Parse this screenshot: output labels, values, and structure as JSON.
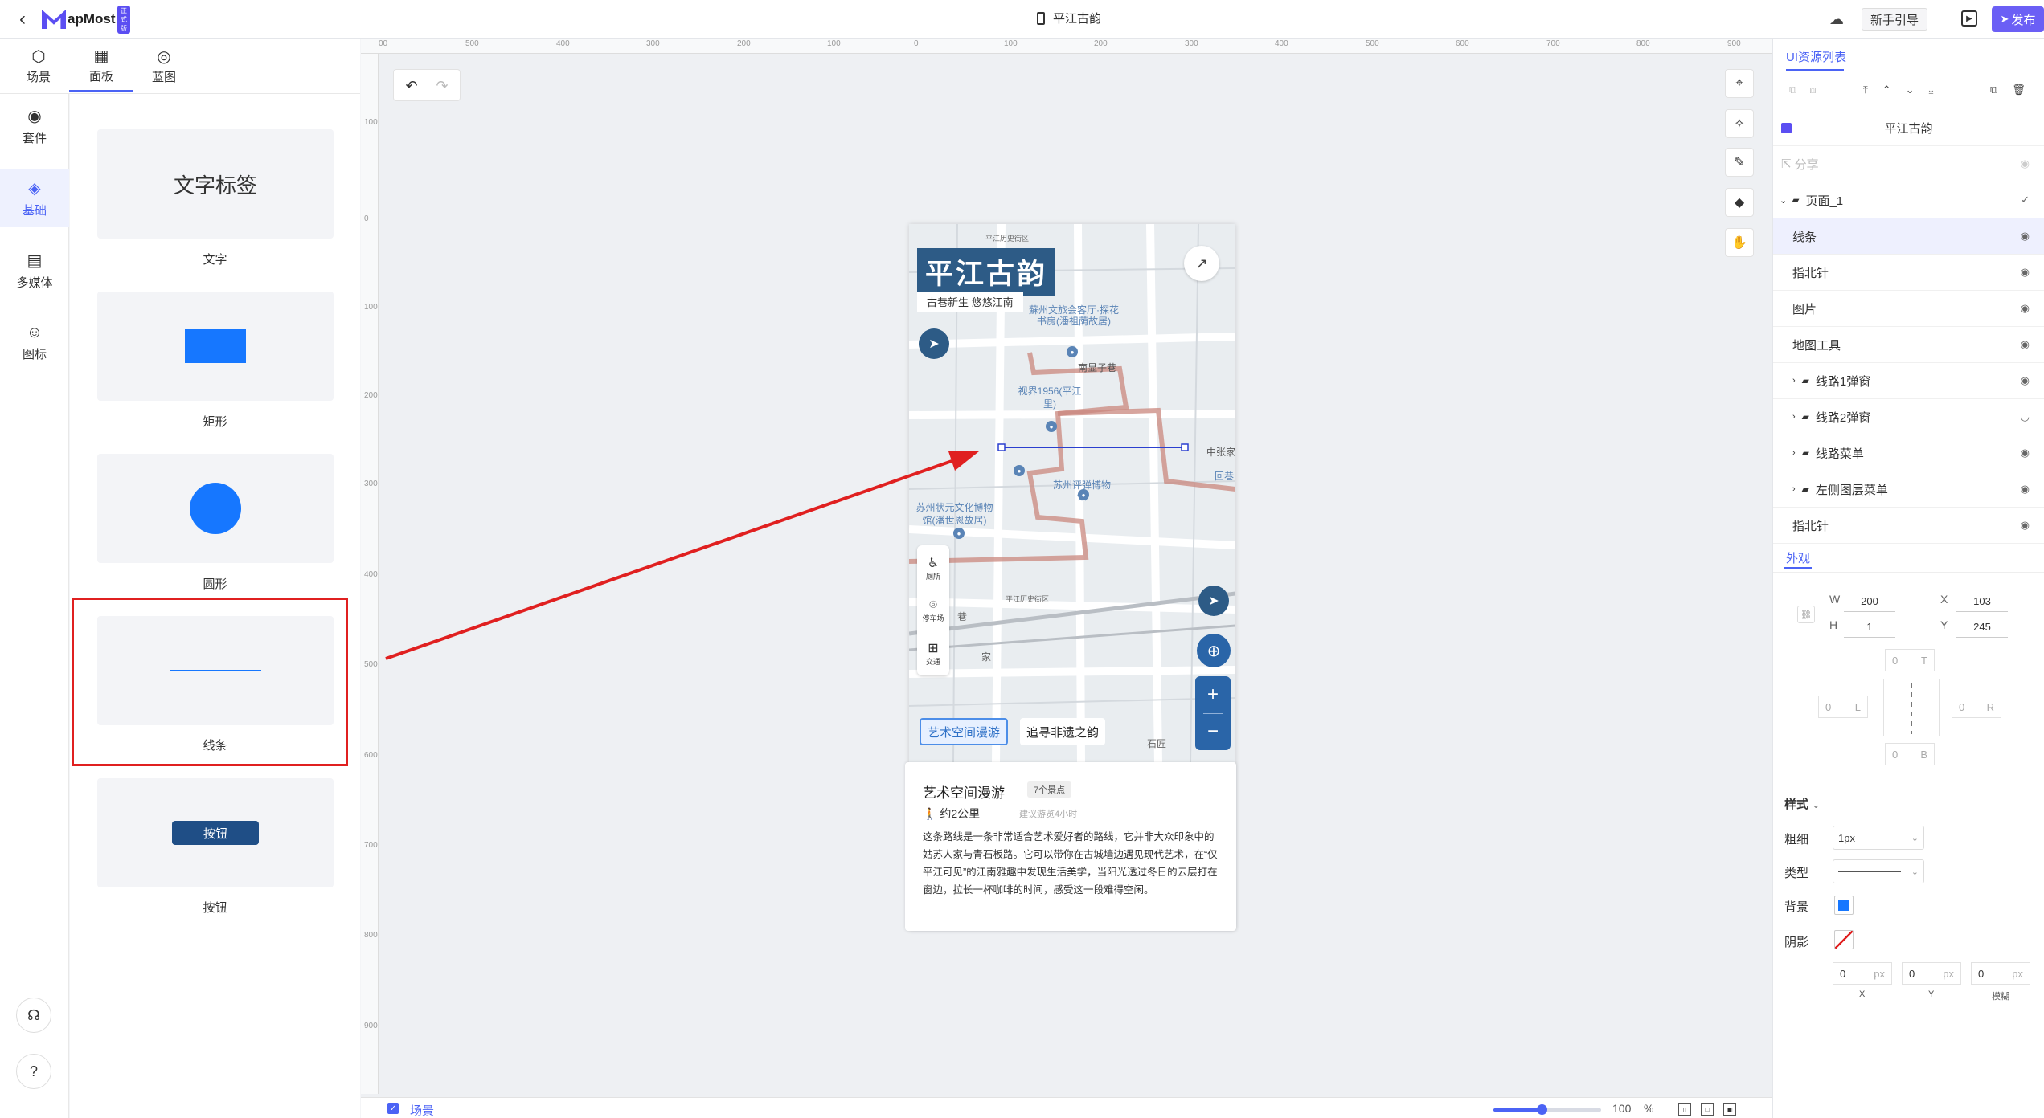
{
  "app": {
    "logo_text": "apMost",
    "logo_badge": "正式版",
    "document_title": "平江古韵"
  },
  "topbar": {
    "guide": "新手引导",
    "publish": "发布"
  },
  "tabs": [
    {
      "label": "场景",
      "icon": "cube-icon"
    },
    {
      "label": "面板",
      "icon": "grid-icon"
    },
    {
      "label": "蓝图",
      "icon": "blueprint-icon"
    }
  ],
  "rail": [
    {
      "label": "套件",
      "icon": "target-icon"
    },
    {
      "label": "基础",
      "icon": "shapes-icon"
    },
    {
      "label": "多媒体",
      "icon": "media-icon"
    },
    {
      "label": "图标",
      "icon": "smile-icon"
    }
  ],
  "palette": {
    "text_preview": "文字标签",
    "button_preview": "按钮",
    "items": [
      "文字",
      "矩形",
      "圆形",
      "线条",
      "按钮"
    ]
  },
  "rulers": {
    "h": [
      "00",
      "500",
      "400",
      "300",
      "200",
      "100",
      "0",
      "100",
      "200",
      "300",
      "400",
      "500",
      "600",
      "700",
      "800",
      "900"
    ],
    "v": [
      "100",
      "0",
      "100",
      "200",
      "300",
      "400",
      "500",
      "600",
      "700",
      "800",
      "900"
    ]
  },
  "phone": {
    "title": "平江古韵",
    "subtitle": "古巷新生 悠悠江南",
    "poi": [
      "厕所",
      "停车场",
      "交通"
    ],
    "route_tabs": [
      "艺术空间漫游",
      "追寻非遗之韵"
    ],
    "map_labels": [
      "平江历史街区",
      "蘇州文旅会客厅·探花书房(潘祖荫故居)",
      "视界1956(平江里)",
      "苏州状元文化博物馆(潘世恩故居)",
      "苏州评弹博物馆",
      "南显子巷",
      "中张家",
      "回巷",
      "平江历史街区",
      "家",
      "巷",
      "石匠"
    ],
    "info": {
      "title": "艺术空间漫游",
      "count": "7个景点",
      "distance": "约2公里",
      "tip": "建议游览4小时",
      "desc": "这条路线是一条非常适合艺术爱好者的路线，它并非大众印象中的姑苏人家与青石板路。它可以带你在古城墙边遇见现代艺术，在“仅平江可见”的江南雅趣中发现生活美学，当阳光透过冬日的云层打在窗边，拉长一杯咖啡的时间，感受这一段难得空闲。"
    }
  },
  "bottombar": {
    "scene": "场景",
    "zoom": "100",
    "zoom_unit": "%",
    "zoom_level": 0.45
  },
  "right_panel": {
    "title": "UI资源列表",
    "root": "平江古韵",
    "share": "分享",
    "page": "页面_1",
    "layers": [
      "线条",
      "指北针",
      "图片",
      "地图工具",
      "线路1弹窗",
      "线路2弹窗",
      "线路菜单",
      "左侧图层菜单",
      "指北针"
    ],
    "appearance_tab": "外观",
    "W": "200",
    "H": "1",
    "X": "103",
    "Y": "245",
    "W_label": "W",
    "H_label": "H",
    "X_label": "X",
    "Y_label": "Y",
    "margin": {
      "T": "T",
      "L": "L",
      "R": "R",
      "B": "B",
      "val": "0"
    },
    "style_title": "样式",
    "weight_label": "粗细",
    "weight": "1px",
    "type_label": "类型",
    "bg_label": "背景",
    "shadow_label": "阴影",
    "shadow": [
      {
        "val": "0",
        "unit": "px",
        "label": "X"
      },
      {
        "val": "0",
        "unit": "px",
        "label": "Y"
      },
      {
        "val": "0",
        "unit": "px",
        "label": "模糊"
      }
    ]
  },
  "colors": {
    "accent": "#4b63f5",
    "brand_title_bg": "#2d5b86",
    "line_swatch": "#1677ff",
    "annotation": "#e02020"
  }
}
